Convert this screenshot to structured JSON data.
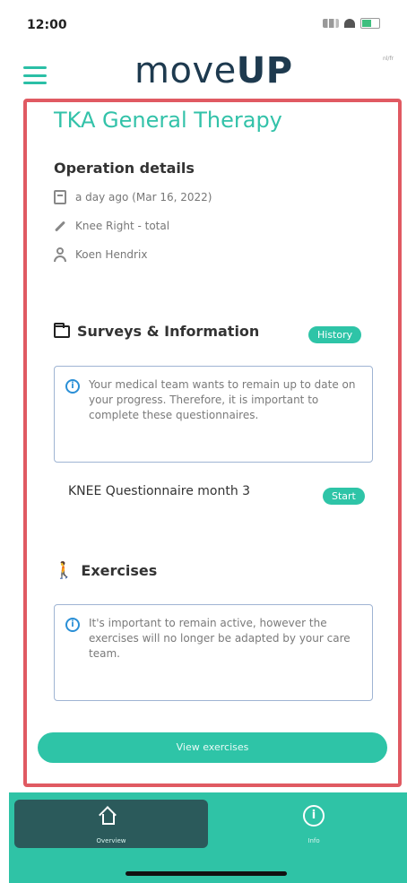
{
  "status_bar": {
    "time": "12:00"
  },
  "header": {
    "logo_light": "move",
    "logo_bold": "UP",
    "lang_label": "nl/fr"
  },
  "therapy": {
    "title": "TKA General Therapy",
    "operation_heading": "Operation details",
    "date": "a day ago (Mar 16, 2022)",
    "procedure": "Knee Right - total",
    "surgeon": "Koen Hendrix"
  },
  "surveys": {
    "heading": "Surveys & Information",
    "history_label": "History",
    "info": "Your medical team wants to remain up to date on your progress. Therefore, it is important to complete these questionnaires.",
    "questionnaire_label": "KNEE Questionnaire month 3",
    "start_label": "Start"
  },
  "exercises": {
    "heading": "Exercises",
    "info": "It's important to remain active, however the exercises will no longer be adapted by your care team.",
    "view_label": "View exercises"
  },
  "bottom_nav": {
    "overview_label": "Overview",
    "info_label": "Info"
  },
  "colors": {
    "accent": "#2ec4a7",
    "frame": "#e05a62",
    "nav_active": "#2b5a5b"
  },
  "icons": [
    "menu-icon",
    "calendar-icon",
    "scalpel-icon",
    "person-icon",
    "folder-icon",
    "info-icon",
    "walking-icon",
    "home-icon"
  ]
}
